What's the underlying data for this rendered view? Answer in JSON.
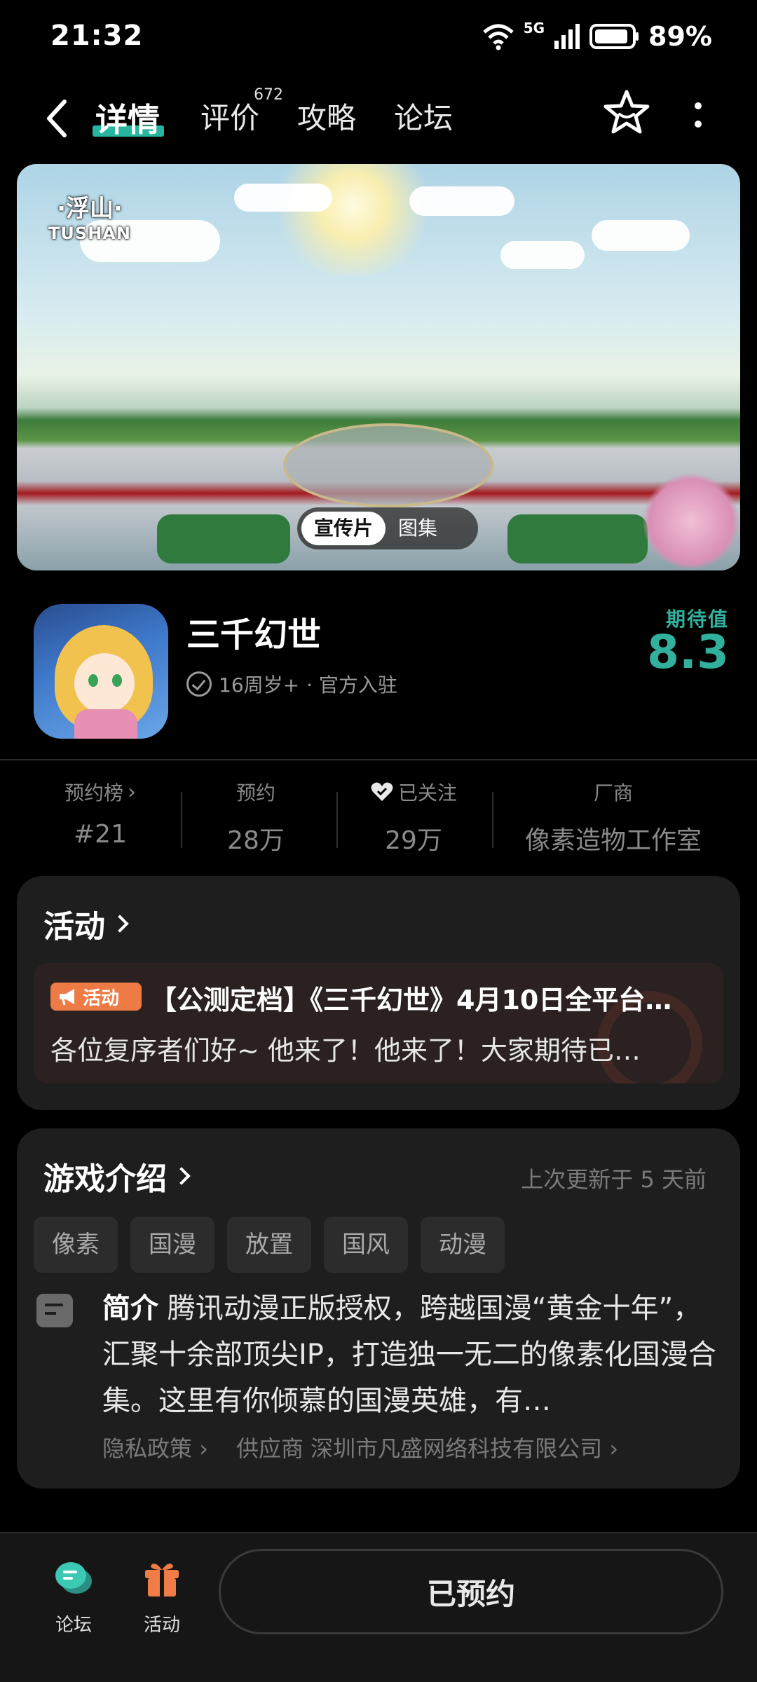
{
  "status_bar": {
    "time": "21:32",
    "network": "5G",
    "battery": "89%"
  },
  "nav": {
    "tabs": [
      {
        "label": "详情",
        "active": true
      },
      {
        "label": "评价"
      },
      {
        "label": "攻略"
      },
      {
        "label": "论坛"
      }
    ],
    "review_count": "672"
  },
  "banner": {
    "logo_line1": "·浮山·",
    "logo_line2": "TUSHAN",
    "segments": [
      "宣传片",
      "图集"
    ]
  },
  "app": {
    "title": "三千幻世",
    "age_rating": "16周岁+",
    "official": "· 官方入驻",
    "expect_label": "期待值",
    "expect_value": "8.3",
    "accent_color": "#31b09e"
  },
  "stats": [
    {
      "label": "预约榜",
      "value": "#21"
    },
    {
      "label": "预约",
      "value": "28万"
    },
    {
      "label": "已关注",
      "value": "29万"
    },
    {
      "label": "厂商",
      "value": "像素造物工作室"
    }
  ],
  "activity": {
    "title": "活动",
    "tag": "活动",
    "headline": "【公测定档】《三千幻世》4月10日全平台…",
    "body": "各位复序者们好~ 他来了！他来了！大家期待已…"
  },
  "intro": {
    "title": "游戏介绍",
    "updated": "上次更新于 5 天前",
    "tags": [
      "像素",
      "国漫",
      "放置",
      "国风",
      "动漫"
    ],
    "label": "简介",
    "text": "腾讯动漫正版授权，跨越国漫“黄金十年”，汇聚十余部顶尖IP，打造独一无二的像素化国漫合集。这里有你倾慕的国漫英雄，有…",
    "privacy": "隐私政策",
    "supplier": "供应商 深圳市凡盛网络科技有限公司"
  },
  "bottom": {
    "forum": "论坛",
    "activity": "活动",
    "reserve": "已预约"
  }
}
